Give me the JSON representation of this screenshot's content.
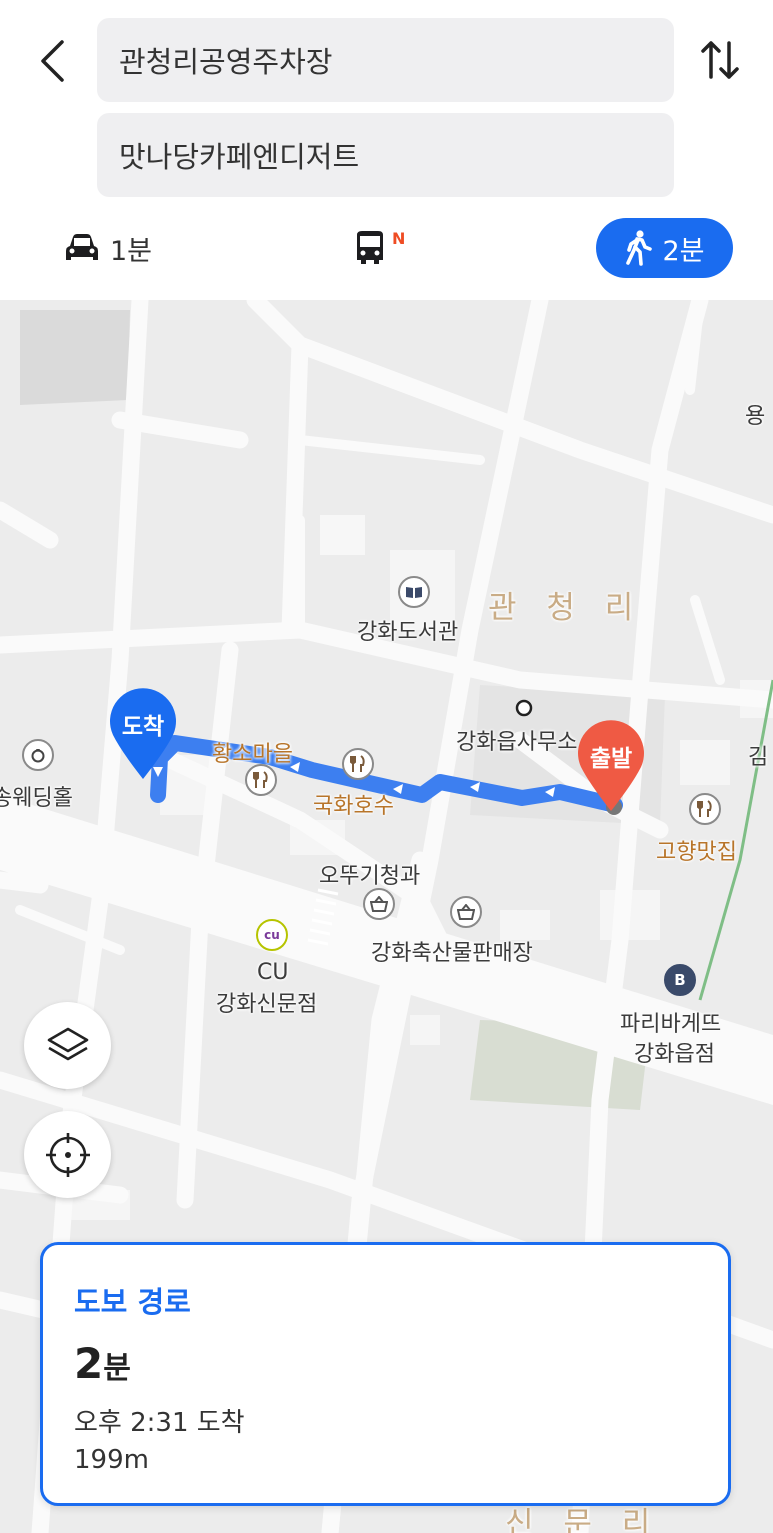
{
  "header": {
    "origin": "관청리공영주차장",
    "destination": "맛나당카페엔디저트"
  },
  "modes": {
    "car": {
      "icon": "car-icon",
      "label": "1분"
    },
    "bus": {
      "icon": "bus-icon",
      "badge": "N"
    },
    "walk": {
      "icon": "walking-icon",
      "label": "2분",
      "selected": true
    }
  },
  "map": {
    "area_name": "관 청 리",
    "labels": {
      "library": "강화도서관",
      "office": "강화읍사무소",
      "hwangso": "황소마을",
      "gukhwa": "국화호수",
      "gohyang": "고향맛집",
      "odduggi": "오뚜기청과",
      "chuksan": "강화축산물판매장",
      "cu_brand": "CU",
      "cu_branch": "강화신문점",
      "paris": "파리바게뜨",
      "paris_branch": "강화읍점",
      "wedding": "송웨딩홀",
      "yong": "용",
      "kim": "김",
      "bottom_area": "신 문 리",
      "cu_logo": "cu"
    },
    "pin_start": "출발",
    "pin_end": "도착",
    "route_color": "#3d7ff0",
    "start_color": "#ef5a44",
    "end_color": "#1a6cf0"
  },
  "controls": {
    "layers_icon": "layers-icon",
    "locate_icon": "crosshair-icon"
  },
  "card": {
    "title": "도보 경로",
    "time_value": "2",
    "time_unit": "분",
    "arrival": "오후 2:31 도착",
    "distance": "199m"
  },
  "colors": {
    "accent": "#1a6cf0",
    "bus_badge": "#ef4c23"
  }
}
